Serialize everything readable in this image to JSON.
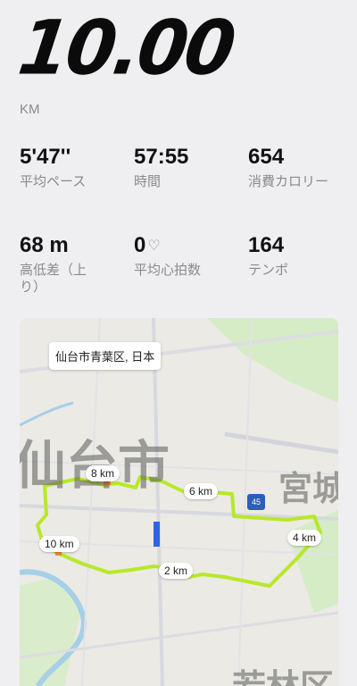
{
  "summary": {
    "distance": "10.00",
    "unit": "KM"
  },
  "stats": [
    {
      "value": "5'47''",
      "label": "平均ペース"
    },
    {
      "value": "57:55",
      "label": "時間"
    },
    {
      "value": "654",
      "label": "消費カロリー"
    },
    {
      "value": "68 m",
      "label": "高低差（上り）"
    },
    {
      "value": "0",
      "label": "平均心拍数",
      "icon": "heart-icon"
    },
    {
      "value": "164",
      "label": "テンポ"
    }
  ],
  "map": {
    "location": "仙台市青葉区, 日本",
    "city_label": "仙台市",
    "district_label": "宮城",
    "ward_label": "若林区",
    "road_shield": "45",
    "route_color": "#b8e82a",
    "km_markers": [
      "2 km",
      "4 km",
      "6 km",
      "8 km",
      "10 km"
    ]
  }
}
